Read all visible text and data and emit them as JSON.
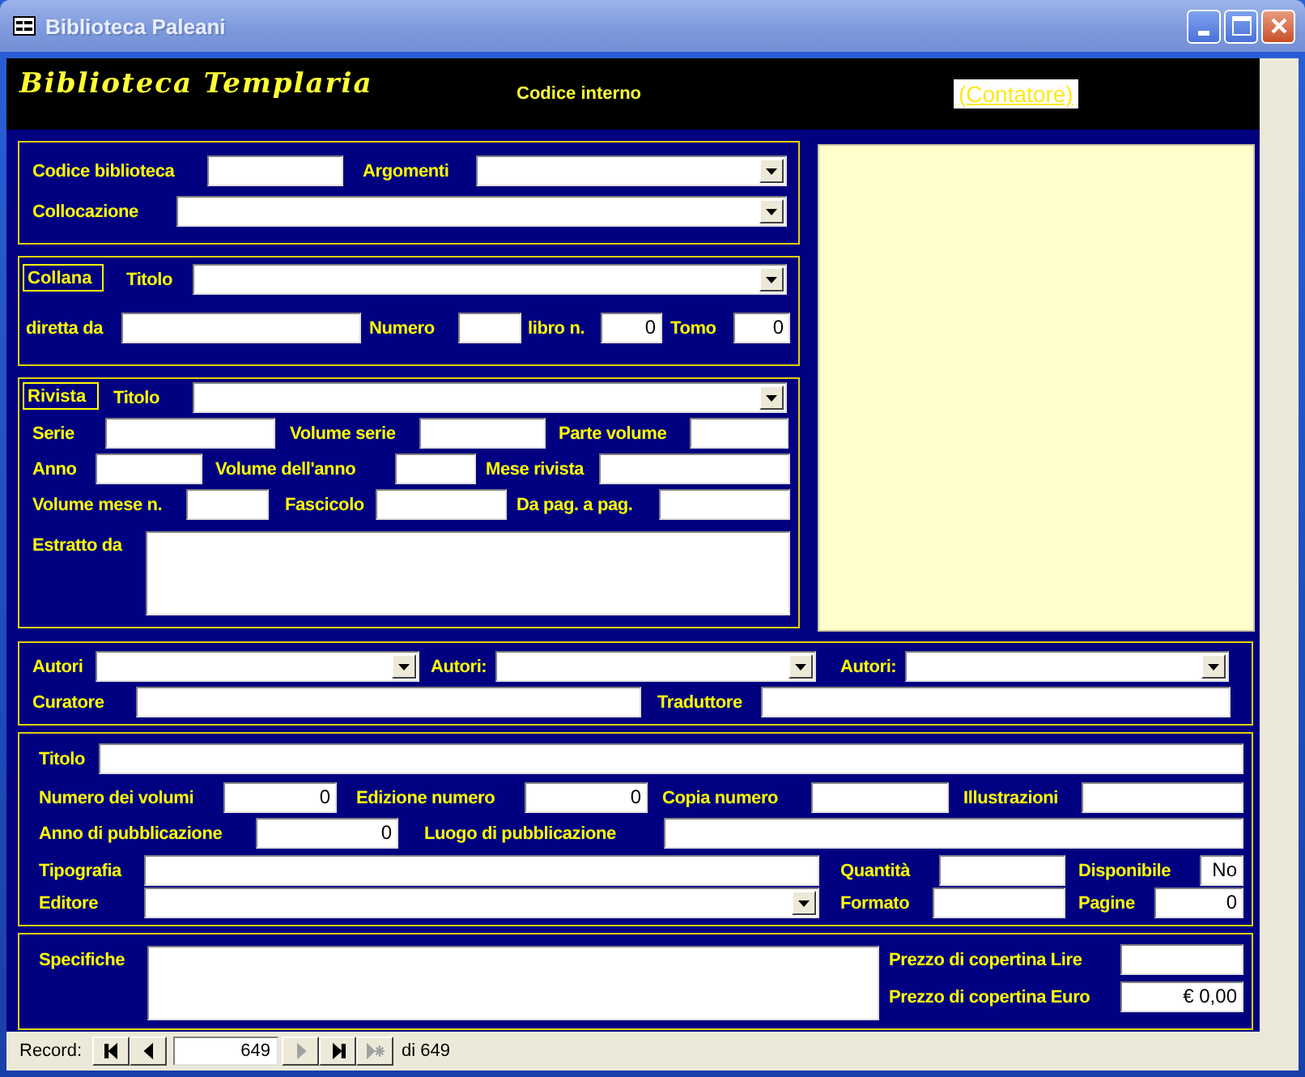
{
  "window": {
    "title": "Biblioteca Paleani"
  },
  "header": {
    "title": "Biblioteca Templaria",
    "code_label": "Codice interno",
    "counter": "(Contatore)"
  },
  "sections": [
    {
      "kind": "plain",
      "rows": [
        [
          {
            "kind": "label",
            "text": "Codice biblioteca"
          },
          {
            "kind": "field"
          },
          {
            "kind": "label",
            "text": "Argomenti"
          },
          {
            "kind": "combo"
          }
        ],
        [
          {
            "kind": "label",
            "text": "Collocazione"
          },
          {
            "kind": "combo"
          }
        ]
      ]
    },
    {
      "kind": "plain",
      "rows": [
        [
          {
            "kind": "legend",
            "text": "Collana"
          },
          {
            "kind": "label",
            "text": "Titolo"
          },
          {
            "kind": "combo"
          }
        ],
        [
          {
            "kind": "label",
            "text": "diretta da"
          },
          {
            "kind": "field"
          },
          {
            "kind": "label",
            "text": "Numero"
          },
          {
            "kind": "field"
          },
          {
            "kind": "label",
            "text": "libro n."
          },
          {
            "kind": "field",
            "value": "0"
          },
          {
            "kind": "label",
            "text": "Tomo"
          },
          {
            "kind": "field",
            "value": "0"
          }
        ]
      ]
    },
    {
      "kind": "plain",
      "rows": [
        [
          {
            "kind": "legend",
            "text": "Rivista"
          },
          {
            "kind": "label",
            "text": "Titolo"
          },
          {
            "kind": "combo"
          }
        ],
        [
          {
            "kind": "label",
            "text": "Serie"
          },
          {
            "kind": "field"
          },
          {
            "kind": "label",
            "text": "Volume serie"
          },
          {
            "kind": "field"
          },
          {
            "kind": "label",
            "text": "Parte volume"
          },
          {
            "kind": "field"
          }
        ],
        [
          {
            "kind": "label",
            "text": "Anno"
          },
          {
            "kind": "field"
          },
          {
            "kind": "label",
            "text": "Volume dell'anno"
          },
          {
            "kind": "field"
          },
          {
            "kind": "label",
            "text": "Mese rivista"
          },
          {
            "kind": "field"
          }
        ],
        [
          {
            "kind": "label",
            "text": "Volume mese n."
          },
          {
            "kind": "field"
          },
          {
            "kind": "label",
            "text": "Fascicolo"
          },
          {
            "kind": "field"
          },
          {
            "kind": "label",
            "text": "Da pag. a pag."
          },
          {
            "kind": "field"
          }
        ],
        [
          {
            "kind": "label",
            "text": "Estratto da"
          },
          {
            "kind": "memo"
          }
        ]
      ]
    },
    {
      "kind": "plain",
      "rows": [
        [
          {
            "kind": "label",
            "text": "Autori"
          },
          {
            "kind": "combo"
          },
          {
            "kind": "label",
            "text": "Autori:"
          },
          {
            "kind": "combo"
          },
          {
            "kind": "label",
            "text": "Autori:"
          },
          {
            "kind": "combo"
          }
        ],
        [
          {
            "kind": "label",
            "text": "Curatore"
          },
          {
            "kind": "field"
          },
          {
            "kind": "label",
            "text": "Traduttore"
          },
          {
            "kind": "field"
          }
        ]
      ]
    },
    {
      "kind": "plain",
      "rows": [
        [
          {
            "kind": "label",
            "text": "Titolo"
          },
          {
            "kind": "field"
          }
        ],
        [
          {
            "kind": "label",
            "text": "Numero dei volumi"
          },
          {
            "kind": "field",
            "value": "0"
          },
          {
            "kind": "label",
            "text": "Edizione numero"
          },
          {
            "kind": "field",
            "value": "0"
          },
          {
            "kind": "label",
            "text": "Copia numero"
          },
          {
            "kind": "field"
          },
          {
            "kind": "label",
            "text": "Illustrazioni"
          },
          {
            "kind": "field"
          }
        ],
        [
          {
            "kind": "label",
            "text": "Anno di pubblicazione"
          },
          {
            "kind": "field",
            "value": "0"
          },
          {
            "kind": "label",
            "text": "Luogo di pubblicazione"
          },
          {
            "kind": "field"
          }
        ],
        [
          {
            "kind": "label",
            "text": "Tipografia"
          },
          {
            "kind": "field"
          },
          {
            "kind": "label",
            "text": "Quantità"
          },
          {
            "kind": "field"
          },
          {
            "kind": "label",
            "text": "Disponibile"
          },
          {
            "kind": "field",
            "value": "No"
          }
        ],
        [
          {
            "kind": "label",
            "text": "Editore"
          },
          {
            "kind": "combo"
          },
          {
            "kind": "label",
            "text": "Formato"
          },
          {
            "kind": "field"
          },
          {
            "kind": "label",
            "text": "Pagine"
          },
          {
            "kind": "field",
            "value": "0"
          }
        ]
      ]
    },
    {
      "kind": "split",
      "rows": [
        [
          {
            "kind": "label",
            "text": "Specifiche"
          },
          {
            "kind": "memo"
          }
        ],
        [
          {
            "kind": "label",
            "text": "Prezzo di copertina Lire"
          },
          {
            "kind": "field"
          }
        ],
        [
          {
            "kind": "label",
            "text": "Prezzo di copertina Euro"
          },
          {
            "kind": "field",
            "value": "€ 0,00"
          }
        ]
      ]
    }
  ],
  "record_nav": {
    "label": "Record:",
    "current": "649",
    "total": "di 649",
    "buttons": [
      {
        "kind": "first",
        "disabled": false
      },
      {
        "kind": "prev",
        "disabled": false
      },
      {
        "kind": "next",
        "disabled": true
      },
      {
        "kind": "last",
        "disabled": false
      },
      {
        "kind": "new",
        "disabled": true
      }
    ]
  }
}
